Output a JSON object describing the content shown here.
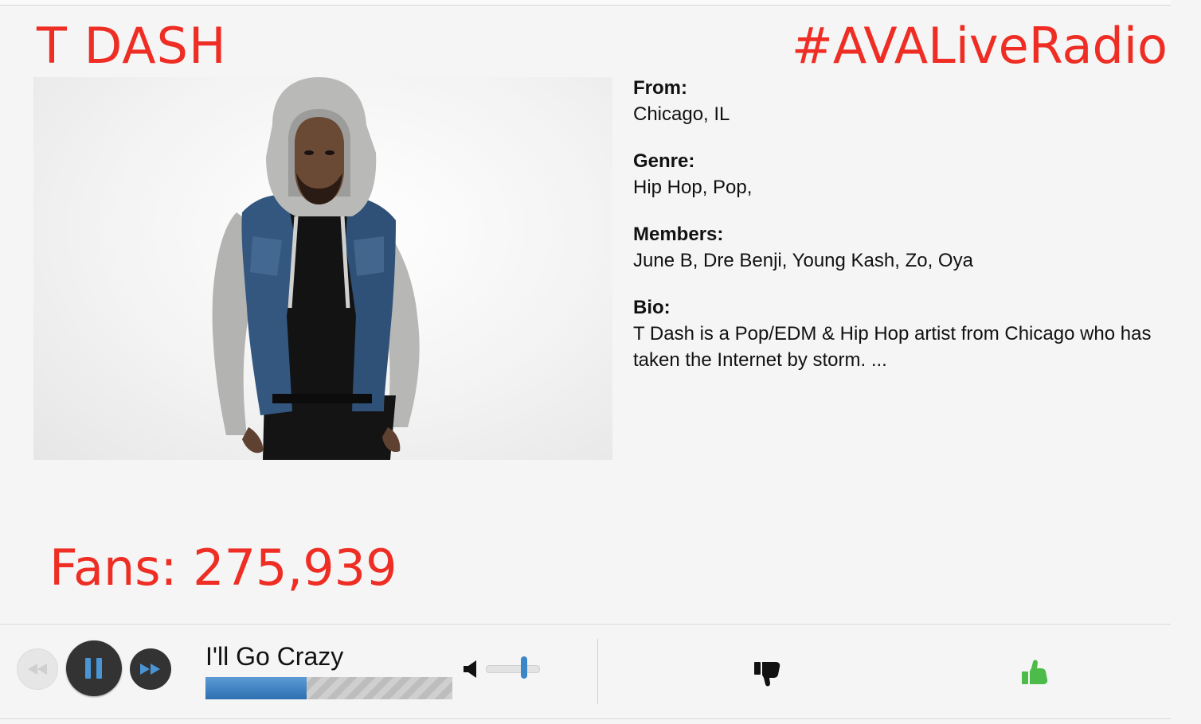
{
  "artist": {
    "name": "T DASH",
    "hashtag": "#AVALiveRadio"
  },
  "info": {
    "from_label": "From:",
    "from_value": "Chicago, IL",
    "genre_label": "Genre:",
    "genre_value": "Hip Hop, Pop,",
    "members_label": "Members:",
    "members_value": "June B, Dre Benji, Young Kash, Zo, Oya",
    "bio_label": "Bio:",
    "bio_value": "T Dash is a Pop/EDM & Hip Hop artist from Chicago who has taken the Internet by storm. ..."
  },
  "fans": {
    "text": "Fans: 275,939"
  },
  "player": {
    "song_title": "I'll Go Crazy",
    "progress_percent": 41,
    "volume_level": 0.72,
    "controls": {
      "rewind_icon": "rewind-icon",
      "pause_icon": "pause-icon",
      "forward_icon": "fast-forward-icon",
      "volume_icon": "speaker-icon"
    }
  },
  "rating": {
    "dislike_icon": "thumbs-down-icon",
    "like_icon": "thumbs-up-icon"
  },
  "colors": {
    "accent": "#ee2e24",
    "progress": "#3b86c8",
    "like": "#4cbb4a",
    "control_dark": "#333333"
  }
}
